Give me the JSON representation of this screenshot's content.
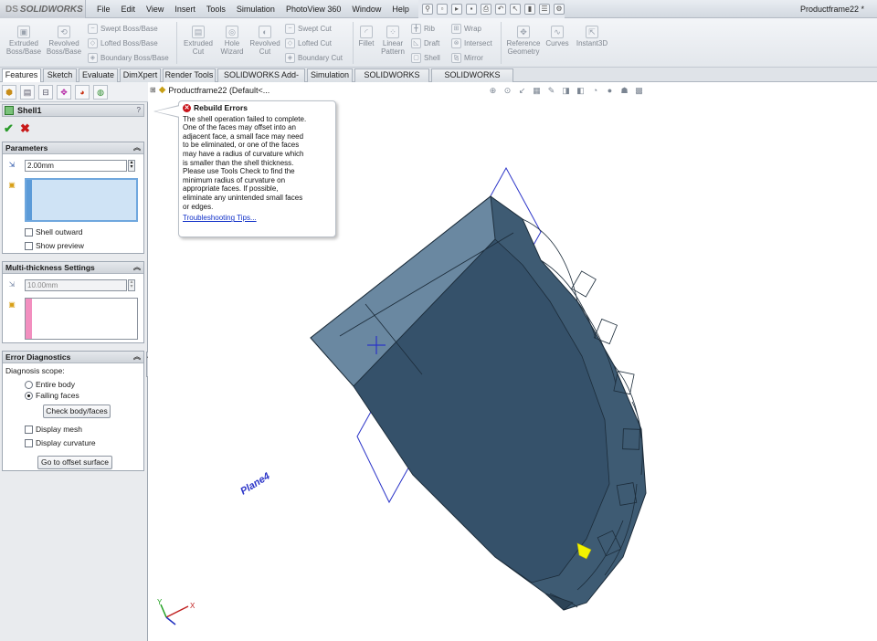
{
  "app": {
    "logo_text": "SOLIDWORKS",
    "logo_prefix": "DS",
    "document_title": "Productframe22 *"
  },
  "menu": [
    "File",
    "Edit",
    "View",
    "Insert",
    "Tools",
    "Simulation",
    "PhotoView 360",
    "Window",
    "Help"
  ],
  "command_manager": {
    "features_big": [
      {
        "label": "Extruded\nBoss/Base",
        "icon": "extruded-boss-icon"
      },
      {
        "label": "Revolved\nBoss/Base",
        "icon": "revolved-boss-icon"
      },
      {
        "label": "Extruded\nCut",
        "icon": "extruded-cut-icon"
      },
      {
        "label": "Hole\nWizard",
        "icon": "hole-wizard-icon"
      },
      {
        "label": "Revolved\nCut",
        "icon": "revolved-cut-icon"
      },
      {
        "label": "Fillet",
        "icon": "fillet-icon"
      },
      {
        "label": "Linear\nPattern",
        "icon": "linear-pattern-icon"
      },
      {
        "label": "Reference\nGeometry",
        "icon": "reference-geometry-icon"
      },
      {
        "label": "Curves",
        "icon": "curves-icon"
      },
      {
        "label": "Instant3D",
        "icon": "instant3d-icon"
      }
    ],
    "boss_small": [
      "Swept Boss/Base",
      "Lofted Boss/Base",
      "Boundary Boss/Base"
    ],
    "cut_small": [
      "Swept Cut",
      "Lofted Cut",
      "Boundary Cut"
    ],
    "rib_small": [
      "Rib",
      "Draft",
      "Shell"
    ],
    "wrap_small": [
      "Wrap",
      "Intersect",
      "Mirror"
    ]
  },
  "tabs": [
    "Features",
    "Sketch",
    "Evaluate",
    "DimXpert",
    "Render Tools",
    "SOLIDWORKS Add-Ins",
    "Simulation",
    "SOLIDWORKS MBD",
    "SOLIDWORKS Plastics"
  ],
  "property_manager": {
    "title": "Shell1",
    "help_glyph": "?",
    "parameters": {
      "header": "Parameters",
      "thickness": "2.00mm",
      "shell_outward": "Shell outward",
      "show_preview": "Show preview"
    },
    "multi_thickness": {
      "header": "Multi-thickness Settings",
      "thickness": "10.00mm"
    },
    "error_diagnostics": {
      "header": "Error Diagnostics",
      "scope_label": "Diagnosis scope:",
      "entire_body": "Entire body",
      "failing_faces": "Failing faces",
      "check_button": "Check body/faces",
      "display_mesh": "Display mesh",
      "display_curvature": "Display curvature",
      "offset_button": "Go to offset surface"
    }
  },
  "tree": {
    "node": "Productframe22  (Default<..."
  },
  "balloon": {
    "title": "Rebuild Errors",
    "body_lines": [
      "The shell operation failed to complete.",
      "One of the faces may offset into an",
      "adjacent face, a small face may need",
      "to be eliminated, or one of the faces",
      "may have a radius of curvature which",
      "is smaller than the shell thickness.",
      "Please use Tools Check to find the",
      "minimum radius of curvature on",
      "appropriate faces. If possible,",
      "eliminate any unintended small faces",
      "or edges."
    ],
    "link": "Troubleshooting Tips..."
  },
  "viewport": {
    "plane_label": "Plane4",
    "triad_x": "X",
    "triad_y": "Y"
  },
  "colors": {
    "model_body": "#3e5b73",
    "plane_outline": "#2b34c8",
    "error_face": "#f2f200",
    "accept": "#2a9a2a",
    "cancel": "#c81818"
  }
}
